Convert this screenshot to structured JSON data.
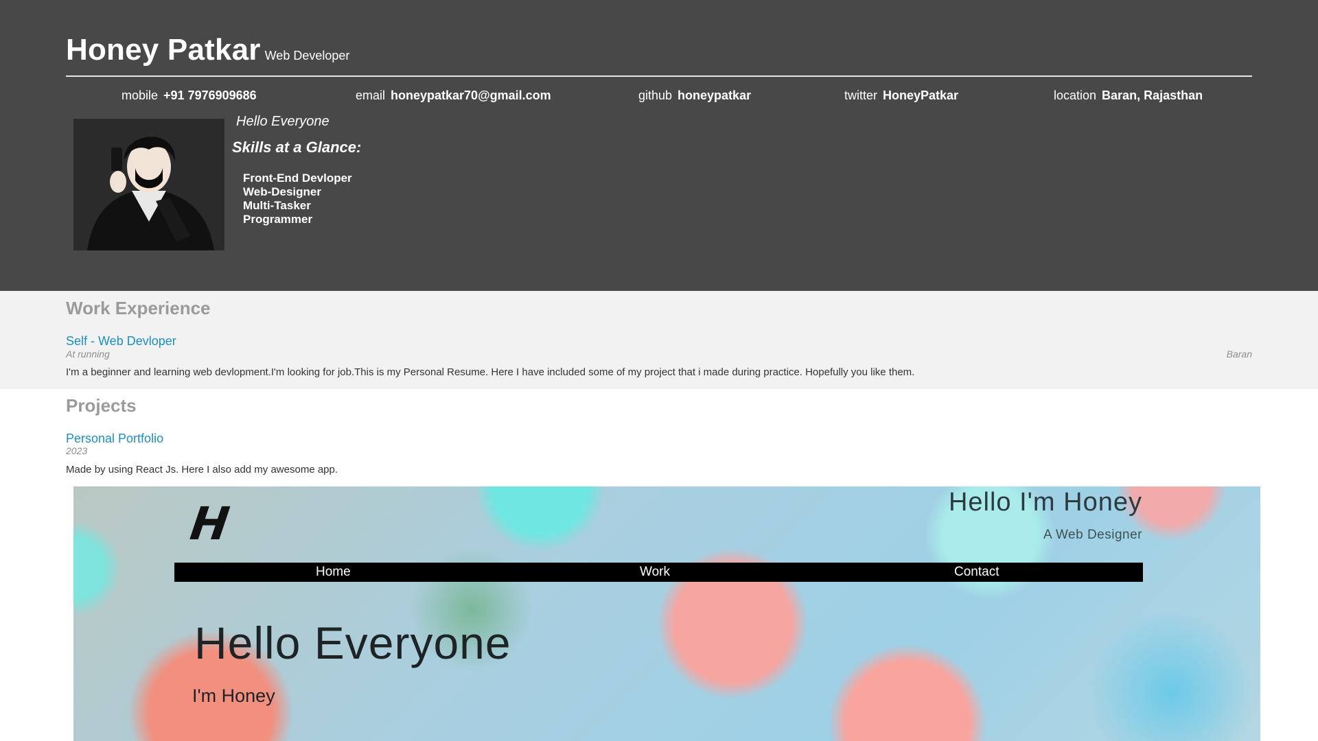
{
  "header": {
    "name": "Honey Patkar",
    "role": "Web Developer",
    "contacts": [
      {
        "label": "mobile",
        "value": "+91 7976909686"
      },
      {
        "label": "email",
        "value": "honeypatkar70@gmail.com"
      },
      {
        "label": "github",
        "value": "honeypatkar"
      },
      {
        "label": "twitter",
        "value": "HoneyPatkar"
      },
      {
        "label": "location",
        "value": "Baran, Rajasthan"
      }
    ],
    "greeting": "Hello Everyone",
    "skills_title": "Skills at a Glance:",
    "skills": [
      "Front-End Devloper",
      "Web-Designer",
      "Multi-Tasker",
      "Programmer"
    ]
  },
  "work": {
    "title": "Work Experience",
    "job_title": "Self - Web Devloper",
    "status": "At running",
    "location": "Baran",
    "description": "I'm a beginner and learning web devlopment.I'm looking for job.This is my Personal Resume. Here I have included some of my project that i made during practice. Hopefully you like them."
  },
  "projects": {
    "title": "Projects",
    "project_title": "Personal Portfolio",
    "year": "2023",
    "description": "Made by using React Js. Here I also add my awesome app."
  },
  "preview": {
    "logo": "H",
    "hero_name": "Hello I'm Honey",
    "hero_subtitle": "A Web Designer",
    "nav": [
      "Home",
      "Work",
      "Contact"
    ],
    "headline": "Hello Everyone",
    "subheadline": "I'm Honey"
  },
  "colors": {
    "header_bg": "#484848",
    "work_bg": "#f2f2f2",
    "link": "#1b8fc0",
    "section_title": "#9a9a9a"
  }
}
